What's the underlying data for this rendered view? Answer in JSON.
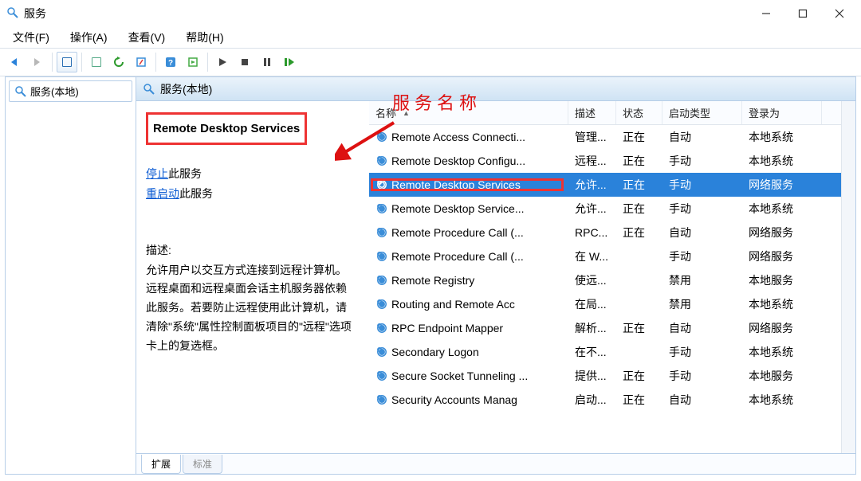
{
  "window": {
    "title": "服务"
  },
  "menubar": {
    "file": "文件(F)",
    "action": "操作(A)",
    "view": "查看(V)",
    "help": "帮助(H)"
  },
  "tree": {
    "root": "服务(本地)"
  },
  "right_header": "服务(本地)",
  "info": {
    "title": "Remote Desktop Services",
    "stop_link": "停止",
    "stop_suffix": "此服务",
    "restart_link": "重启动",
    "restart_suffix": "此服务",
    "desc_label": "描述:",
    "desc": "允许用户以交互方式连接到远程计算机。远程桌面和远程桌面会话主机服务器依赖此服务。若要防止远程使用此计算机，请清除\"系统\"属性控制面板项目的\"远程\"选项卡上的复选框。"
  },
  "columns": {
    "name": "名称",
    "desc": "描述",
    "status": "状态",
    "startup": "启动类型",
    "logon": "登录为"
  },
  "services": [
    {
      "name": "Remote Access Connecti...",
      "desc": "管理...",
      "status": "正在",
      "startup": "自动",
      "logon": "本地系统"
    },
    {
      "name": "Remote Desktop Configu...",
      "desc": "远程...",
      "status": "正在",
      "startup": "手动",
      "logon": "本地系统"
    },
    {
      "name": "Remote Desktop Services",
      "desc": "允许...",
      "status": "正在",
      "startup": "手动",
      "logon": "网络服务",
      "selected": true,
      "highlight": true
    },
    {
      "name": "Remote Desktop Service...",
      "desc": "允许...",
      "status": "正在",
      "startup": "手动",
      "logon": "本地系统"
    },
    {
      "name": "Remote Procedure Call (...",
      "desc": "RPC...",
      "status": "正在",
      "startup": "自动",
      "logon": "网络服务"
    },
    {
      "name": "Remote Procedure Call (...",
      "desc": "在 W...",
      "status": "",
      "startup": "手动",
      "logon": "网络服务"
    },
    {
      "name": "Remote Registry",
      "desc": "使远...",
      "status": "",
      "startup": "禁用",
      "logon": "本地服务"
    },
    {
      "name": "Routing and Remote Acc",
      "desc": "在局...",
      "status": "",
      "startup": "禁用",
      "logon": "本地系统"
    },
    {
      "name": "RPC Endpoint Mapper",
      "desc": "解析...",
      "status": "正在",
      "startup": "自动",
      "logon": "网络服务"
    },
    {
      "name": "Secondary Logon",
      "desc": "在不...",
      "status": "",
      "startup": "手动",
      "logon": "本地系统"
    },
    {
      "name": "Secure Socket Tunneling ...",
      "desc": "提供...",
      "status": "正在",
      "startup": "手动",
      "logon": "本地服务"
    },
    {
      "name": "Security Accounts Manag",
      "desc": "启动...",
      "status": "正在",
      "startup": "自动",
      "logon": "本地系统"
    }
  ],
  "tabs": {
    "extended": "扩展",
    "standard": "标准"
  },
  "annotation": {
    "label": "服务名称"
  }
}
